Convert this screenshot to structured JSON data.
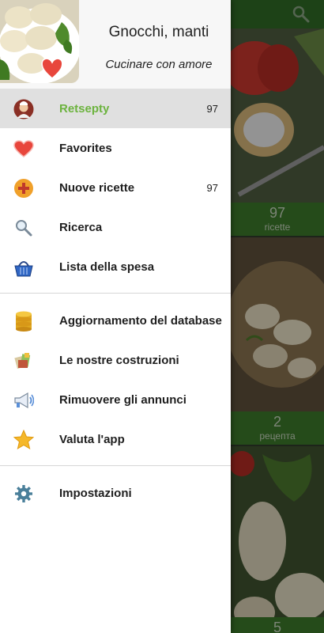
{
  "header": {
    "title": "Gnocchi, manti",
    "subtitle": "Cucinare con amore"
  },
  "menu_primary": [
    {
      "label": "Retsepty",
      "badge": "97",
      "icon": "chef-avatar-icon",
      "active": true
    },
    {
      "label": "Favorites",
      "badge": "",
      "icon": "heart-icon"
    },
    {
      "label": "Nuove ricette",
      "badge": "97",
      "icon": "add-plus-icon"
    },
    {
      "label": "Ricerca",
      "badge": "",
      "icon": "search-icon"
    },
    {
      "label": "Lista della spesa",
      "badge": "",
      "icon": "shopping-basket-icon"
    }
  ],
  "menu_secondary": [
    {
      "label": "Aggiornamento del database",
      "icon": "database-icon"
    },
    {
      "label": "Le nostre costruzioni",
      "icon": "apps-icon"
    },
    {
      "label": "Rimuovere gli annunci",
      "icon": "megaphone-icon"
    },
    {
      "label": "Valuta l'app",
      "icon": "star-icon"
    }
  ],
  "menu_settings": {
    "label": "Impostazioni",
    "icon": "gear-icon"
  },
  "background_cards": [
    {
      "count": "97",
      "label": "ricette"
    },
    {
      "count": "2",
      "label": "рецепта"
    },
    {
      "count": "5",
      "label": ""
    }
  ],
  "colors": {
    "accent_green": "#6cb33e",
    "toolbar_green": "#2f6b26",
    "active_row": "#e0e0e0"
  }
}
